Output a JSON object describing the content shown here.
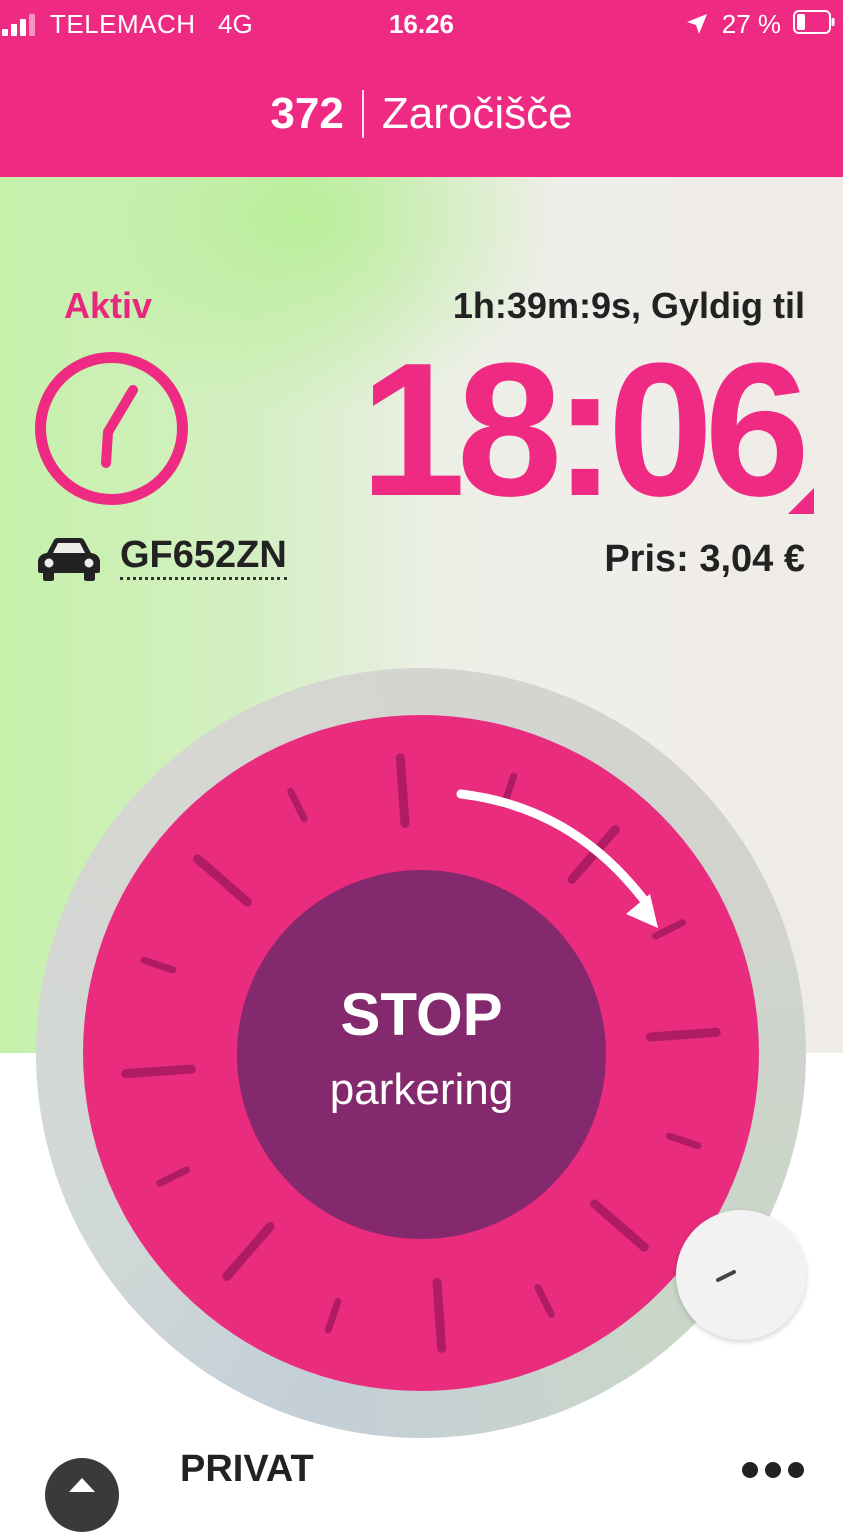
{
  "status_bar": {
    "carrier": "TELEMACH",
    "network": "4G",
    "time": "16.26",
    "battery": "27 %",
    "icons": [
      "signal-icon",
      "location-arrow-icon",
      "battery-icon"
    ]
  },
  "header": {
    "zone_number": "372",
    "zone_name": "Zaročišče"
  },
  "parking": {
    "status": "Aktiv",
    "remaining": "1h:39m:9s, Gyldig til",
    "end_time": "18:06",
    "plate": "GF652ZN",
    "price": "Pris: 3,04 €",
    "icons": [
      "clock-icon",
      "car-icon"
    ]
  },
  "stop_button": {
    "title": "STOP",
    "subtitle": "parkering"
  },
  "bottom": {
    "account": "PRIVAT",
    "icons": [
      "chevron-up-icon",
      "more-icon"
    ]
  },
  "colors": {
    "accent": "#ef2a82",
    "stop_center": "#84296d",
    "active_green": "#c5f1aa"
  }
}
